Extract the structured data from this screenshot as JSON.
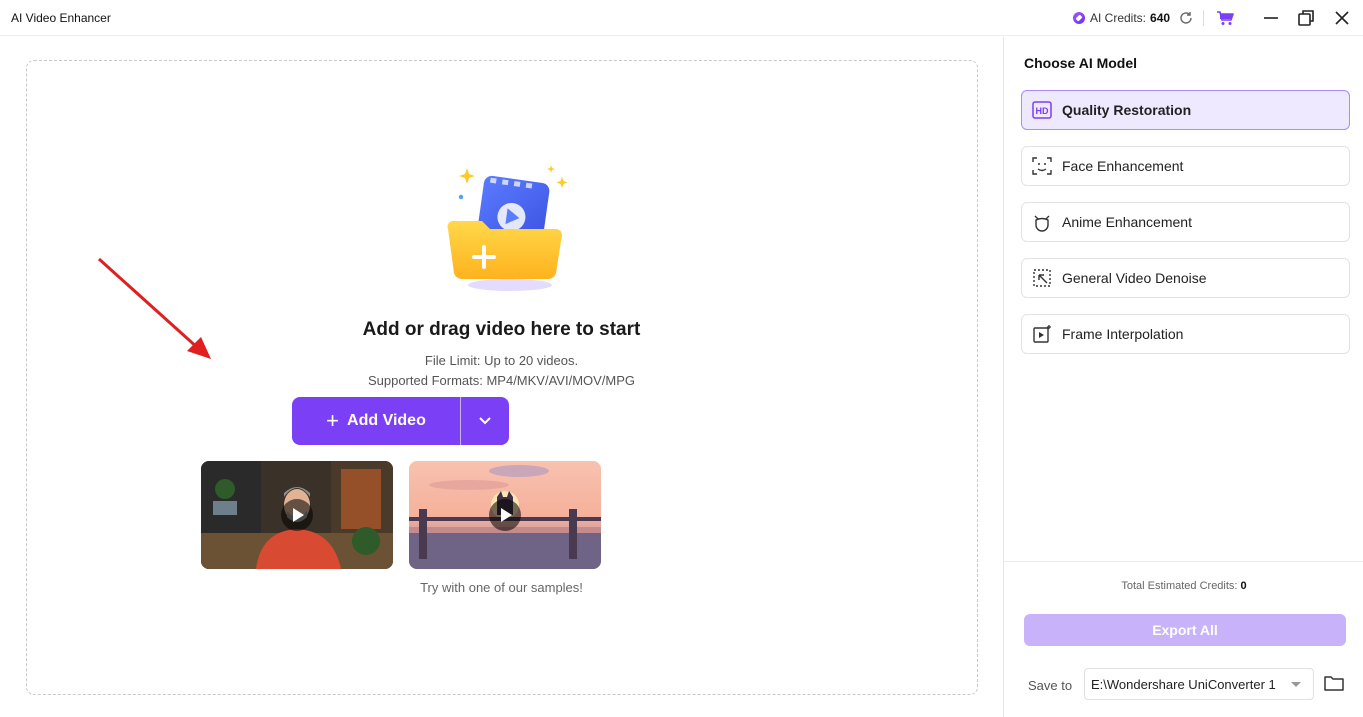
{
  "titlebar": {
    "app_title": "AI Video Enhancer",
    "credits_label": "AI Credits:",
    "credits_value": "640"
  },
  "dropzone": {
    "headline": "Add or drag video here to start",
    "file_limit": "File Limit: Up to 20 videos.",
    "formats": "Supported Formats: MP4/MKV/AVI/MOV/MPG",
    "add_video_label": "Add Video",
    "samples_caption": "Try with one of our samples!"
  },
  "sidebar": {
    "title": "Choose AI Model",
    "models": [
      {
        "label": "Quality Restoration",
        "icon": "hd-icon",
        "active": true
      },
      {
        "label": "Face Enhancement",
        "icon": "face-scan-icon",
        "active": false
      },
      {
        "label": "Anime Enhancement",
        "icon": "anime-head-icon",
        "active": false
      },
      {
        "label": "General Video Denoise",
        "icon": "denoise-icon",
        "active": false
      },
      {
        "label": "Frame Interpolation",
        "icon": "frame-interpolation-icon",
        "active": false
      }
    ],
    "estimated_label": "Total Estimated Credits:",
    "estimated_value": "0",
    "export_label": "Export All",
    "save_to_label": "Save to",
    "save_path": "E:\\Wondershare UniConverter 1"
  },
  "colors": {
    "accent": "#7b3ff5",
    "accent_light": "#efe9ff",
    "export_disabled": "#c8b3fb",
    "arrow": "#e02020"
  }
}
